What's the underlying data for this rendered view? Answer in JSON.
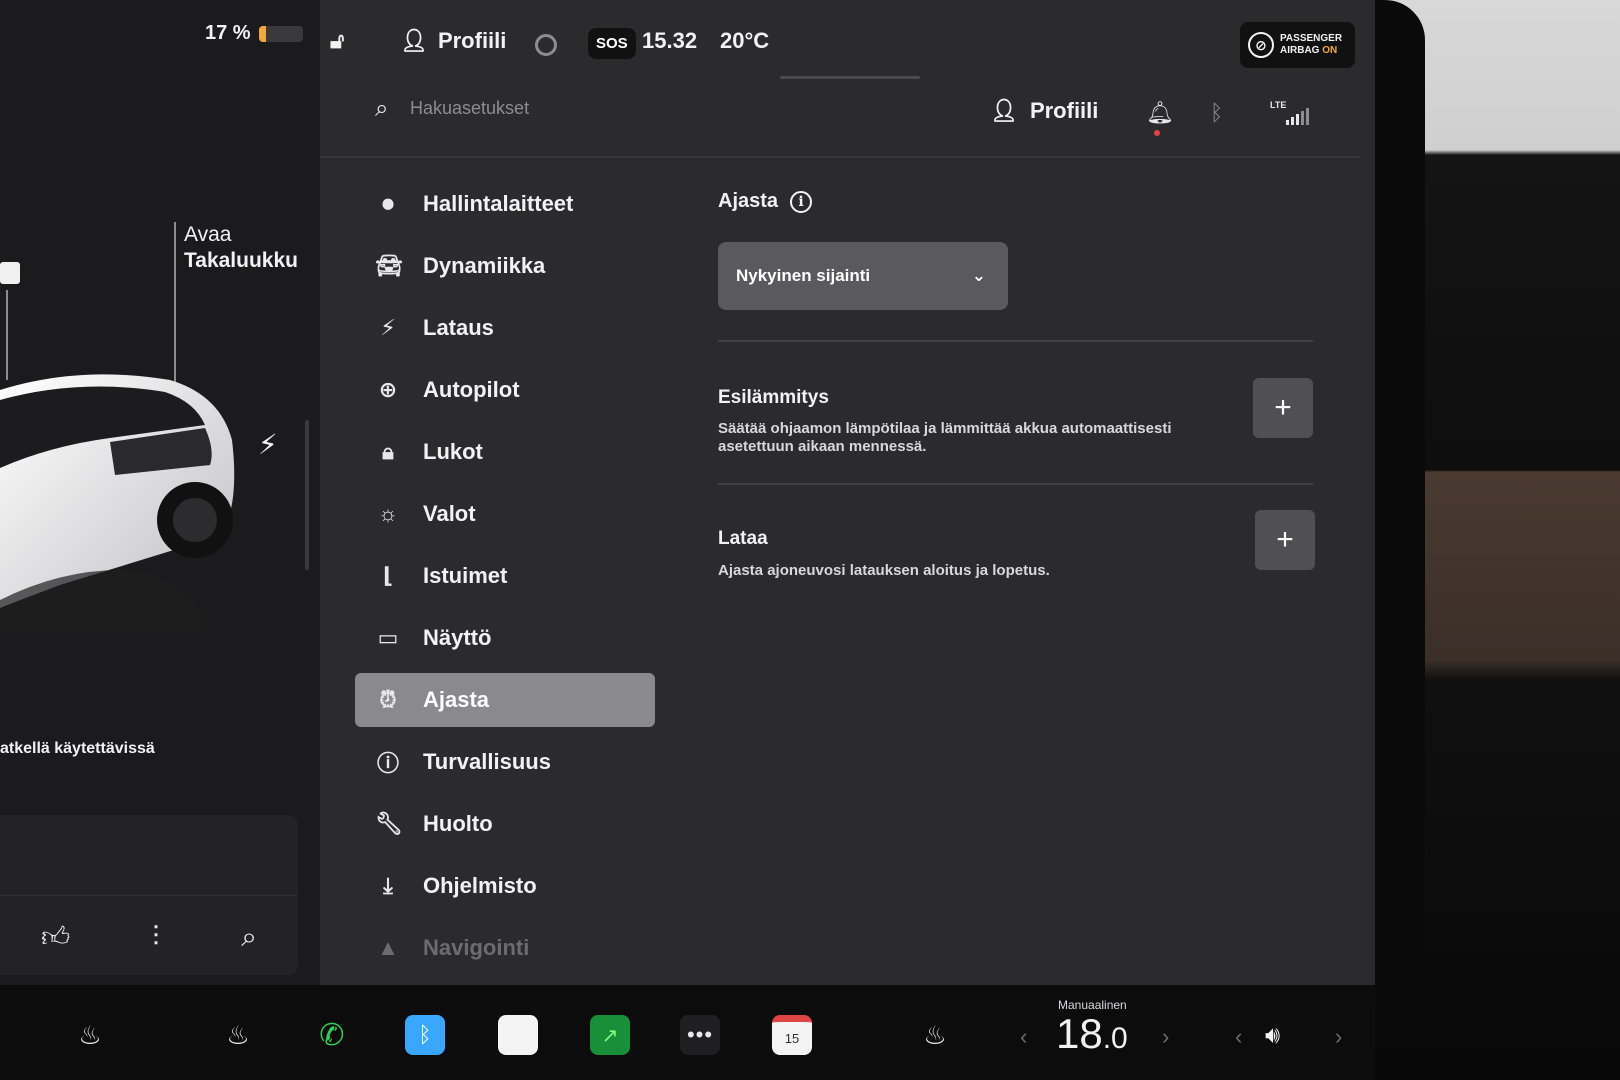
{
  "status_bar": {
    "battery_percent": "17 %",
    "battery_level": 0.17,
    "profile_label": "Profiili",
    "sos_label": "SOS",
    "time": "15.32",
    "temperature": "20°C",
    "airbag_line1": "PASSENGER",
    "airbag_line2": "AIRBAG",
    "airbag_state": "ON"
  },
  "car_panel": {
    "trunk_label_line1": "Avaa",
    "trunk_label_line2": "Takaluukku",
    "charge_note": "atkellä käytettävissä"
  },
  "header": {
    "search_placeholder": "Hakuasetukset",
    "profile_label": "Profiili",
    "network": "LTE"
  },
  "sidebar": {
    "items": [
      {
        "label": "Hallintalaitteet",
        "icon": "toggle-icon"
      },
      {
        "label": "Dynamiikka",
        "icon": "car-icon"
      },
      {
        "label": "Lataus",
        "icon": "bolt-icon"
      },
      {
        "label": "Autopilot",
        "icon": "steering-wheel-icon"
      },
      {
        "label": "Lukot",
        "icon": "lock-icon"
      },
      {
        "label": "Valot",
        "icon": "sun-icon"
      },
      {
        "label": "Istuimet",
        "icon": "seat-icon"
      },
      {
        "label": "Näyttö",
        "icon": "display-icon"
      },
      {
        "label": "Ajasta",
        "icon": "alarm-clock-icon",
        "active": true
      },
      {
        "label": "Turvallisuus",
        "icon": "alert-circle-icon"
      },
      {
        "label": "Huolto",
        "icon": "wrench-icon"
      },
      {
        "label": "Ohjelmisto",
        "icon": "download-icon"
      },
      {
        "label": "Navigointi",
        "icon": "navigation-icon"
      }
    ]
  },
  "content": {
    "section_title": "Ajasta",
    "location_select": "Nykyinen sijainti",
    "preheat": {
      "title": "Esilämmitys",
      "description": "Säätää ohjaamon lämpötilaa ja lämmittää akkua automaattisesti asetettuun aikaan mennessä."
    },
    "charge": {
      "title": "Lataa",
      "description": "Ajasta ajoneuvosi latauksen aloitus ja lopetus."
    }
  },
  "taskbar": {
    "climate_mode": "Manuaalinen",
    "temp_int": "18",
    "temp_dec": ".0",
    "calendar_day": "15"
  },
  "colors": {
    "panel_bg": "#2b2b2e",
    "active_item": "#8a8a8e",
    "accent_orange": "#f2a93b",
    "phone_green": "#2ed15a",
    "bluetooth_blue": "#3aa7ff"
  }
}
